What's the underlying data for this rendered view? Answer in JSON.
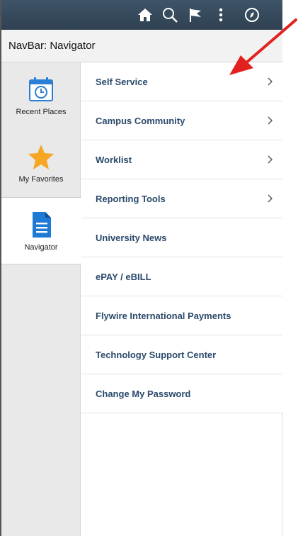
{
  "header": {
    "title": "NavBar: Navigator"
  },
  "topbar": {
    "icons": [
      "home-icon",
      "search-icon",
      "flag-icon",
      "more-vertical-icon",
      "compass-icon"
    ]
  },
  "left_nav": {
    "items": [
      {
        "label": "Recent Places",
        "icon": "calendar-clock-icon"
      },
      {
        "label": "My Favorites",
        "icon": "star-icon"
      },
      {
        "label": "Navigator",
        "icon": "document-icon",
        "active": true
      }
    ]
  },
  "menu": {
    "items": [
      {
        "label": "Self Service",
        "has_children": true
      },
      {
        "label": "Campus Community",
        "has_children": true
      },
      {
        "label": "Worklist",
        "has_children": true
      },
      {
        "label": "Reporting Tools",
        "has_children": true
      },
      {
        "label": "University News",
        "has_children": false
      },
      {
        "label": "ePAY / eBILL",
        "has_children": false
      },
      {
        "label": "Flywire International Payments",
        "has_children": false
      },
      {
        "label": "Technology Support Center",
        "has_children": false
      },
      {
        "label": "Change My Password",
        "has_children": false
      }
    ]
  },
  "colors": {
    "topbar": "#34495c",
    "menu_text": "#2b4a6b",
    "star": "#f5a623",
    "calendar": "#2a7fd4",
    "document": "#1f7ad6",
    "annotation_arrow": "#e0211d"
  }
}
